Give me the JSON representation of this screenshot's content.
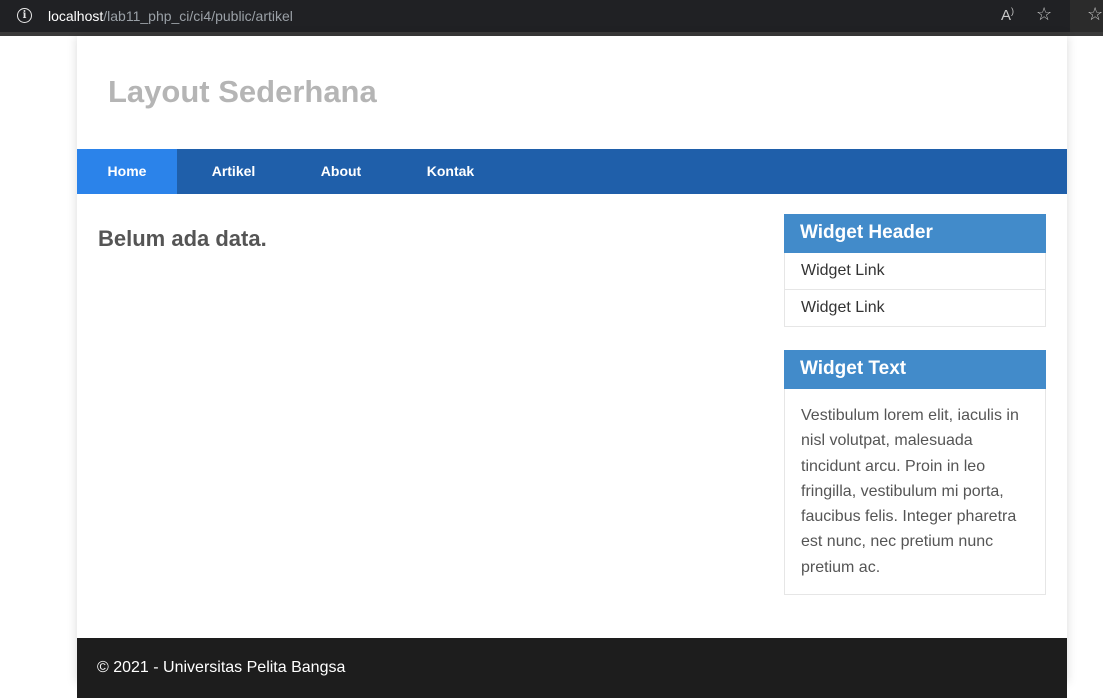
{
  "browser": {
    "url_host": "localhost",
    "url_path": "/lab11_php_ci/ci4/public/artikel",
    "info_icon": "info-icon",
    "read_aloud_icon": "read-aloud-icon",
    "favorites_icon": "add-favorite-icon",
    "collections_icon": "favorites-icon"
  },
  "site": {
    "title": "Layout Sederhana"
  },
  "nav": {
    "items": [
      {
        "label": "Home",
        "active": true
      },
      {
        "label": "Artikel",
        "active": false
      },
      {
        "label": "About",
        "active": false
      },
      {
        "label": "Kontak",
        "active": false
      }
    ]
  },
  "main": {
    "message": "Belum ada data."
  },
  "sidebar": {
    "widget_links": {
      "header": "Widget Header",
      "links": [
        "Widget Link",
        "Widget Link"
      ]
    },
    "widget_text": {
      "header": "Widget Text",
      "body": "Vestibulum lorem elit, iaculis in nisl volutpat, malesuada tincidunt arcu. Proin in leo fringilla, vestibulum mi porta, faucibus felis. Integer pharetra est nunc, nec pretium nunc pretium ac."
    }
  },
  "footer": {
    "text": "© 2021 - Universitas Pelita Bangsa"
  },
  "colors": {
    "nav_bg": "#1f5faa",
    "nav_active": "#2b83ea",
    "widget_header": "#428bca",
    "footer_bg": "#1d1d1d"
  }
}
